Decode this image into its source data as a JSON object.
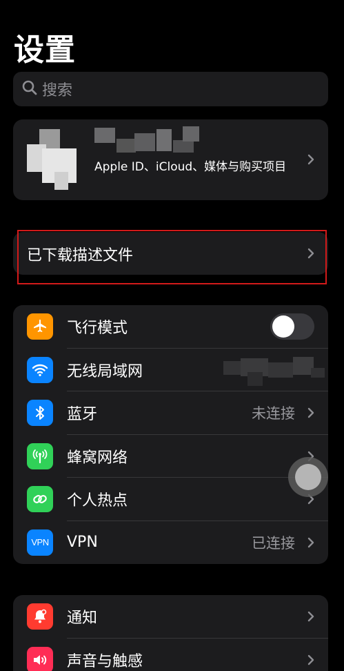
{
  "header": {
    "title": "设置"
  },
  "search": {
    "placeholder": "搜索"
  },
  "account": {
    "subtitle": "Apple ID、iCloud、媒体与购买项目"
  },
  "profile_downloaded": {
    "label": "已下载描述文件"
  },
  "network_rows": [
    {
      "label": "飞行模式",
      "icon": "airplane-icon",
      "color": "#ff9500",
      "control": "toggle",
      "on": false
    },
    {
      "label": "无线局域网",
      "icon": "wifi-icon",
      "color": "#0a84ff",
      "value": ""
    },
    {
      "label": "蓝牙",
      "icon": "bluetooth-icon",
      "color": "#0a84ff",
      "value": "未连接"
    },
    {
      "label": "蜂窝网络",
      "icon": "antenna-icon",
      "color": "#30d158",
      "value": ""
    },
    {
      "label": "个人热点",
      "icon": "hotspot-icon",
      "color": "#30d158",
      "value": ""
    },
    {
      "label": "VPN",
      "icon": "vpn-icon",
      "icon_text": "VPN",
      "color": "#0a84ff",
      "value": "已连接"
    }
  ],
  "notification_rows": [
    {
      "label": "通知",
      "icon": "bell-icon",
      "color": "#ff3b30"
    },
    {
      "label": "声音与触感",
      "icon": "speaker-icon",
      "color": "#ff2d55"
    }
  ]
}
